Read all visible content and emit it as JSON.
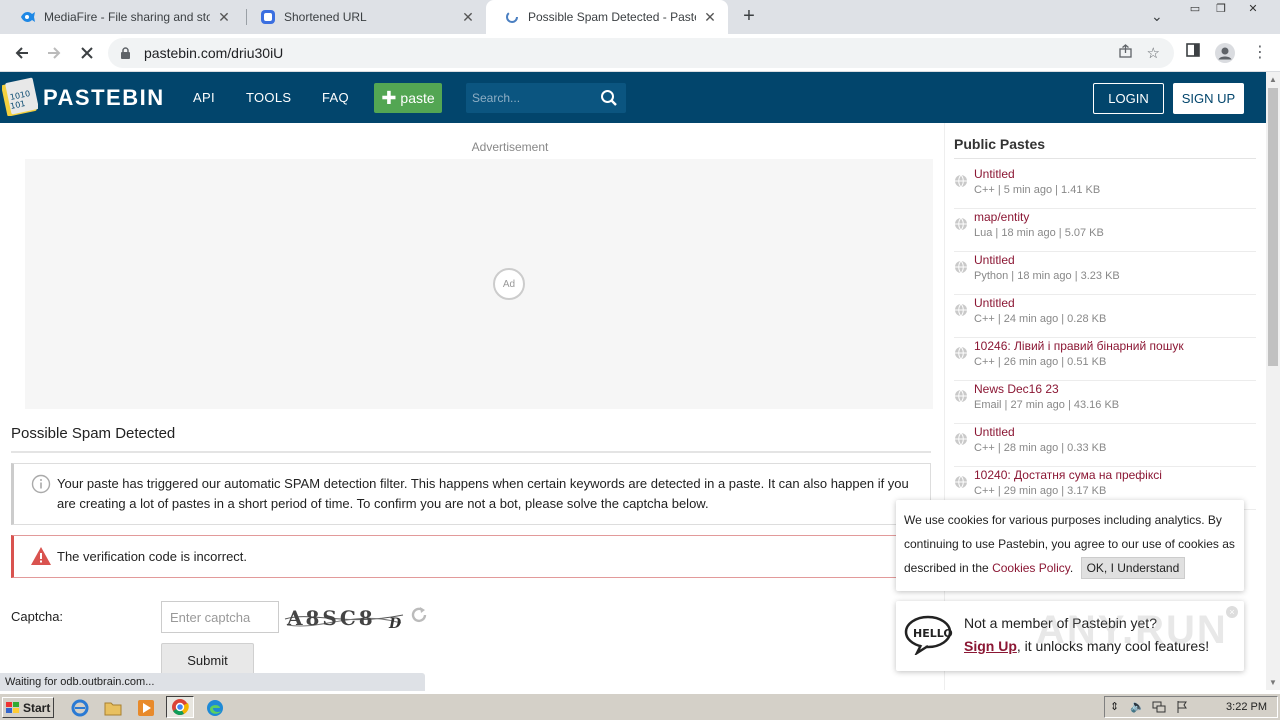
{
  "browser": {
    "tabs": [
      {
        "title": "MediaFire - File sharing and storage m"
      },
      {
        "title": "Shortened URL"
      },
      {
        "title": "Possible Spam Detected - Pastebin.c"
      }
    ],
    "url": "pastebin.com/driu30iU",
    "status_text": "Waiting for odb.outbrain.com..."
  },
  "header": {
    "brand": "PASTEBIN",
    "nav": [
      "API",
      "TOOLS",
      "FAQ"
    ],
    "paste_label": "paste",
    "search_placeholder": "Search...",
    "login_label": "LOGIN",
    "signup_label": "SIGN UP"
  },
  "main": {
    "ad_label": "Advertisement",
    "ad_badge": "Ad",
    "title": "Possible Spam Detected",
    "info_text": "Your paste has triggered our automatic SPAM detection filter. This happens when certain keywords are detected in a paste. It can also happen if you are creating a lot of pastes in a short period of time. To confirm you are not a bot, please solve the captcha below.",
    "error_text": "The verification code is incorrect.",
    "captcha_label": "Captcha:",
    "captcha_placeholder": "Enter captcha",
    "captcha_image_text": "A8SC8",
    "captcha_image_tail": "D",
    "submit_label": "Submit"
  },
  "sidebar": {
    "title": "Public Pastes",
    "items": [
      {
        "name": "Untitled",
        "meta": "C++ | 5 min ago | 1.41 KB"
      },
      {
        "name": "map/entity",
        "meta": "Lua | 18 min ago | 5.07 KB"
      },
      {
        "name": "Untitled",
        "meta": "Python | 18 min ago | 3.23 KB"
      },
      {
        "name": "Untitled",
        "meta": "C++ | 24 min ago | 0.28 KB"
      },
      {
        "name": "10246: Лівий і правий бінарний пошук",
        "meta": "C++ | 26 min ago | 0.51 KB"
      },
      {
        "name": "News Dec16 23",
        "meta": "Email | 27 min ago | 43.16 KB"
      },
      {
        "name": "Untitled",
        "meta": "C++ | 28 min ago | 0.33 KB"
      },
      {
        "name": "10240: Достатня сума на префіксі",
        "meta": "C++ | 29 min ago | 3.17 KB"
      }
    ]
  },
  "cookie": {
    "text_before": "We use cookies for various purposes including analytics. By continuing to use Pastebin, you agree to our use of cookies as described in the ",
    "link": "Cookies Policy",
    "text_after": ".",
    "button": "OK, I Understand"
  },
  "promo": {
    "line1": "Not a member of Pastebin yet?",
    "signup": "Sign Up",
    "line2_rest": ", it unlocks many cool features!",
    "close": "×"
  },
  "watermark": "ANY.RUN",
  "taskbar": {
    "start": "Start",
    "clock": "3:22 PM"
  },
  "colors": {
    "header_bg": "#02456c",
    "paste_btn": "#53a653",
    "link": "#8b1734",
    "error_border": "#d9534f"
  }
}
